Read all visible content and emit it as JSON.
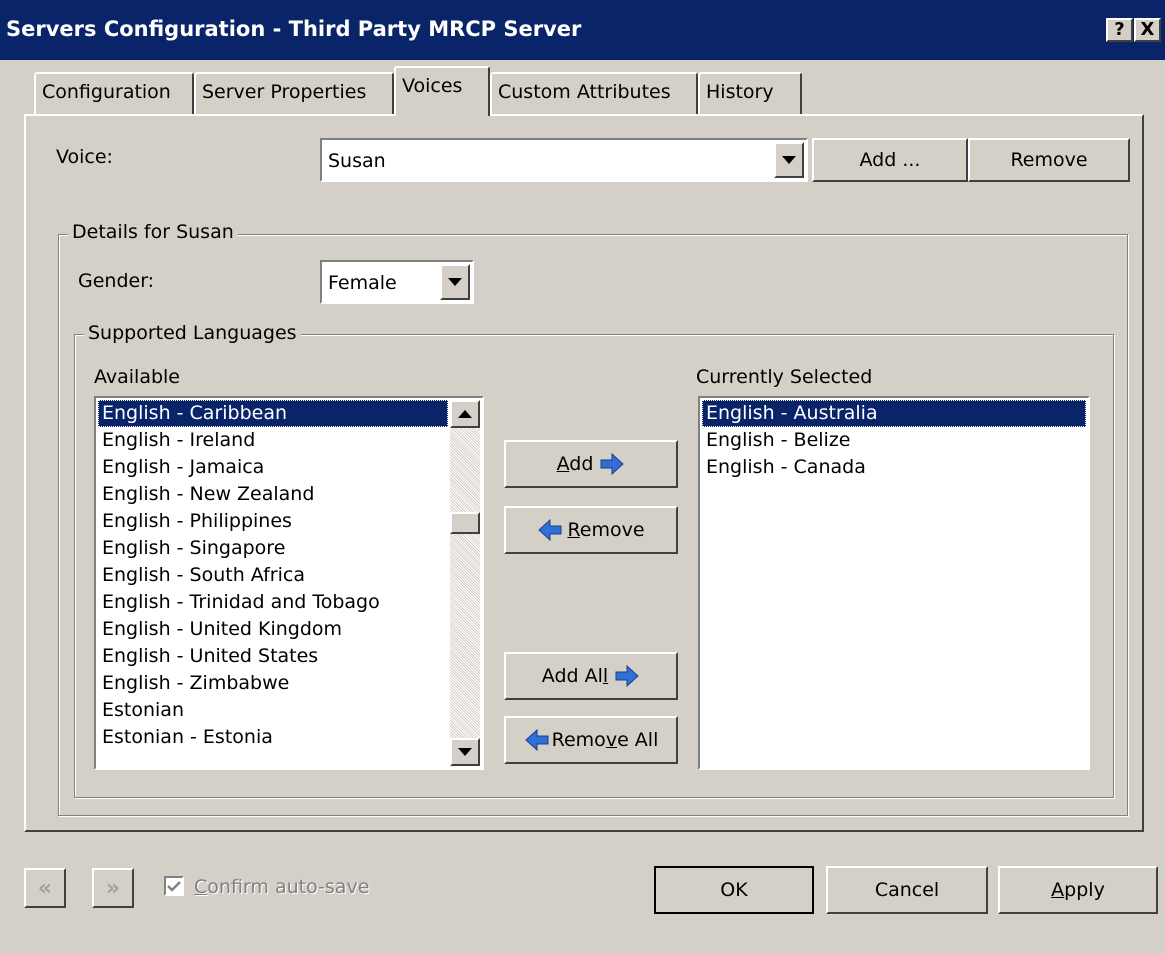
{
  "window": {
    "title": "Servers Configuration - Third Party MRCP Server",
    "help_label": "?",
    "close_label": "X"
  },
  "tabs": [
    {
      "label": "Configuration",
      "active": false
    },
    {
      "label": "Server Properties",
      "active": false
    },
    {
      "label": "Voices",
      "active": true
    },
    {
      "label": "Custom Attributes",
      "active": false
    },
    {
      "label": "History",
      "active": false
    }
  ],
  "voice": {
    "label": "Voice:",
    "value": "Susan",
    "add_label": "Add ...",
    "remove_label": "Remove"
  },
  "details": {
    "legend": "Details for Susan",
    "gender_label": "Gender:",
    "gender_value": "Female"
  },
  "languages": {
    "legend": "Supported Languages",
    "available_label": "Available",
    "selected_label": "Currently Selected",
    "available": [
      "English - Caribbean",
      "English - Ireland",
      "English - Jamaica",
      "English - New Zealand",
      "English - Philippines",
      "English - Singapore",
      "English - South Africa",
      "English - Trinidad and Tobago",
      "English - United Kingdom",
      "English - United States",
      "English - Zimbabwe",
      "Estonian",
      "Estonian - Estonia"
    ],
    "available_selected_index": 0,
    "selected": [
      "English - Australia",
      "English - Belize",
      "English - Canada"
    ],
    "selected_selected_index": 0,
    "add_label": "Add",
    "remove_label": "Remove",
    "add_all_label": "Add All",
    "remove_all_label": "Remove All"
  },
  "footer": {
    "prev_label": "«",
    "next_label": "»",
    "confirm_autosave_label": "Confirm auto-save",
    "confirm_autosave_checked": true,
    "ok_label": "OK",
    "cancel_label": "Cancel",
    "apply_label": "Apply"
  },
  "colors": {
    "titlebar": "#0a246a",
    "face": "#d4d0c8",
    "selection": "#0a246a",
    "arrow_blue": "#2f6fd6"
  }
}
